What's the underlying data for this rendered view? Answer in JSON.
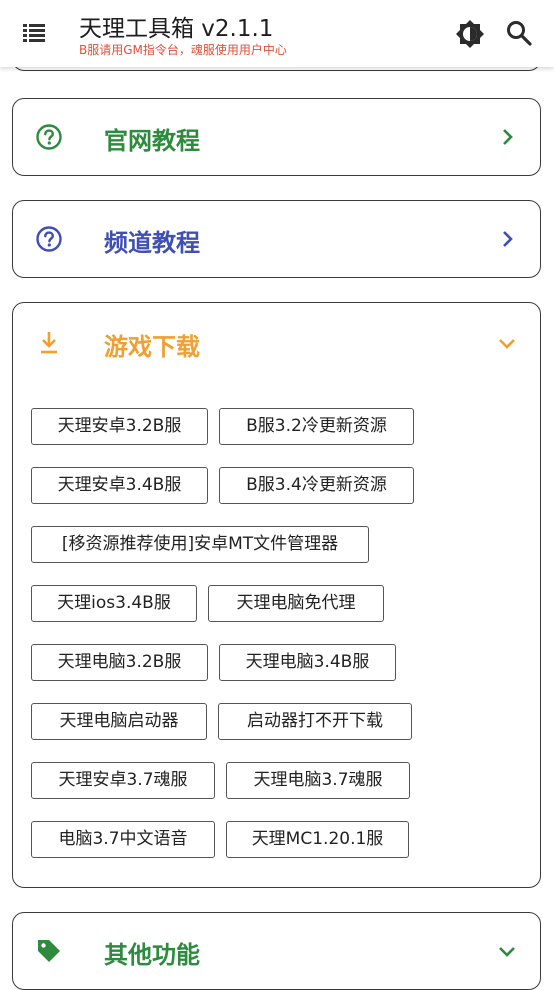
{
  "header": {
    "title": "天理工具箱 v2.1.1",
    "subtitle": "B服请用GM指令台，魂服使用用户中心"
  },
  "cards": {
    "official": {
      "label": "官网教程",
      "color": "#2e8b3e"
    },
    "channel": {
      "label": "频道教程",
      "color": "#3f4fb3"
    },
    "download": {
      "label": "游戏下载",
      "color": "#f0a030"
    },
    "other": {
      "label": "其他功能",
      "color": "#2e8b3e"
    }
  },
  "downloads": [
    "天理安卓3.2B服",
    "B服3.2冷更新资源",
    "天理安卓3.4B服",
    "B服3.4冷更新资源",
    "[移资源推荐使用]安卓MT文件管理器",
    "天理ios3.4B服",
    "天理电脑免代理",
    "天理电脑3.2B服",
    "天理电脑3.4B服",
    "天理电脑启动器",
    "启动器打不开下载",
    "天理安卓3.7魂服",
    "天理电脑3.7魂服",
    "电脑3.7中文语音",
    "天理MC1.20.1服"
  ]
}
